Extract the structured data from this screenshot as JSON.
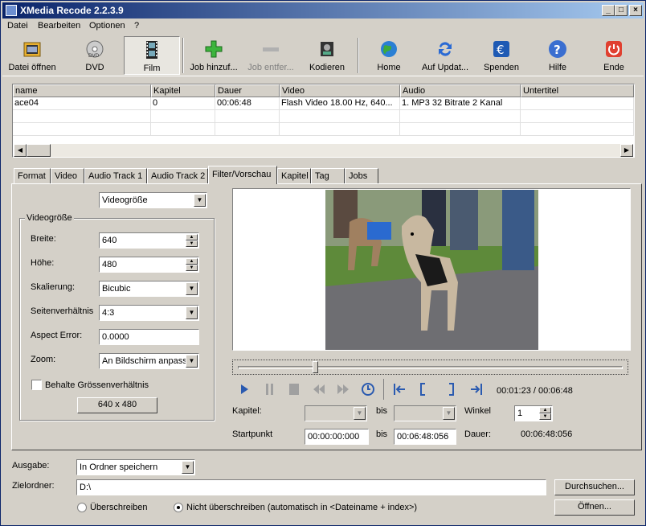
{
  "window": {
    "title": "XMedia Recode 2.2.3.9",
    "controls": [
      "minimize",
      "maximize",
      "close"
    ]
  },
  "menu": [
    "Datei",
    "Bearbeiten",
    "Optionen",
    "?"
  ],
  "toolbar": {
    "open": "Datei öffnen",
    "dvd": "DVD",
    "film": "Film",
    "add_job": "Job hinzuf...",
    "remove_job": "Job entfer...",
    "encode": "Kodieren",
    "home": "Home",
    "update": "Auf Updat...",
    "donate": "Spenden",
    "help": "Hilfe",
    "exit": "Ende"
  },
  "grid": {
    "columns": [
      "name",
      "Kapitel",
      "Dauer",
      "Video",
      "Audio",
      "Untertitel"
    ],
    "rows": [
      {
        "name": "ace04",
        "kapitel": "0",
        "dauer": "00:06:48",
        "video": "Flash Video 18.00 Hz, 640...",
        "audio": "1. MP3 32 Bitrate 2 Kanal",
        "untertitel": ""
      }
    ]
  },
  "tabs": [
    "Format",
    "Video",
    "Audio Track 1",
    "Audio Track 2",
    "Filter/Vorschau",
    "Kapitel",
    "Tag",
    "Jobs"
  ],
  "filter": {
    "selected_filter": "Videogröße",
    "group_title": "Videogröße",
    "width_label": "Breite:",
    "width_value": "640",
    "height_label": "Höhe:",
    "height_value": "480",
    "scaling_label": "Skalierung:",
    "scaling_value": "Bicubic",
    "aspect_label": "Seitenverhältnis",
    "aspect_value": "4:3",
    "aspect_error_label": "Aspect Error:",
    "aspect_error_value": "0.0000",
    "zoom_label": "Zoom:",
    "zoom_value": "An Bildschirm anpasse",
    "keep_ratio_label": "Behalte Grössenverhältnis",
    "size_button": "640 x 480"
  },
  "player": {
    "time": "00:01:23 / 00:06:48",
    "seek_fraction": 0.2,
    "chapter_label": "Kapitel:",
    "bis1": "bis",
    "angle_label": "Winkel",
    "angle_value": "1",
    "start_label": "Startpunkt",
    "start_value": "00:00:00:000",
    "bis2": "bis",
    "end_value": "00:06:48:056",
    "duration_label": "Dauer:",
    "duration_value": "00:06:48:056"
  },
  "output": {
    "label": "Ausgabe:",
    "value": "In Ordner speichern",
    "dest_label": "Zielordner:",
    "dest_value": "D:\\",
    "browse": "Durchsuchen...",
    "open": "Öffnen...",
    "overwrite": "Überschreiben",
    "no_overwrite": "Nicht überschreiben (automatisch in <Dateiname + index>)"
  }
}
